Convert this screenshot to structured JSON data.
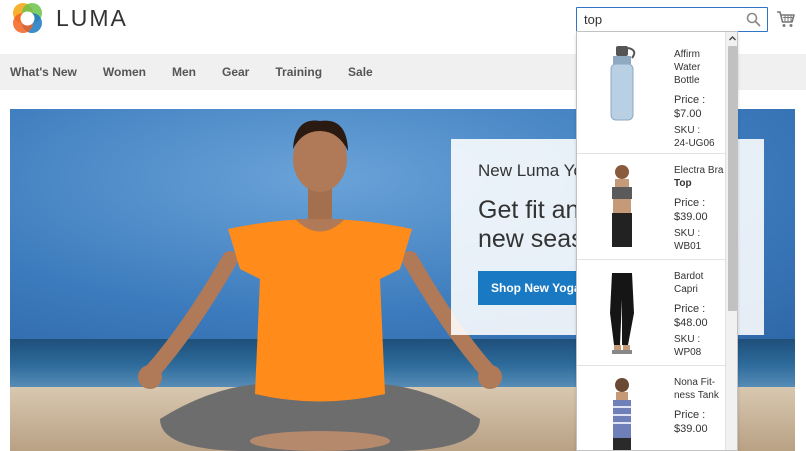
{
  "brand": {
    "name": "LUMA",
    "logo_colors": [
      "#f26322",
      "#f6a81c",
      "#6cc24a",
      "#1979c3"
    ]
  },
  "search": {
    "value": "top",
    "icon": "search-icon"
  },
  "cart": {
    "icon": "cart-icon"
  },
  "nav": {
    "items": [
      "What's New",
      "Women",
      "Men",
      "Gear",
      "Training",
      "Sale"
    ]
  },
  "hero": {
    "eyebrow": "New Luma Yoga Collection",
    "headline": "Get fit and look fab in new seasonal styles",
    "button": "Shop New Yoga"
  },
  "autocomplete": {
    "price_label": "Price :",
    "sku_label": "SKU :",
    "results": [
      {
        "name_pre": "Affirm Water Bottle",
        "name_match": "",
        "price": "$7.00",
        "sku": "24-UG06"
      },
      {
        "name_pre": "Electra Bra ",
        "name_match": "Top",
        "price": "$39.00",
        "sku": "WB01"
      },
      {
        "name_pre": "Bardot Capri",
        "name_match": "",
        "price": "$48.00",
        "sku": "WP08"
      },
      {
        "name_pre": "Nona Fit-ness Tank",
        "name_match": "",
        "price": "$39.00",
        "sku": ""
      }
    ]
  },
  "colors": {
    "accent": "#1979c3",
    "nav_bg": "#f0f0f0",
    "search_border": "#2e76c5"
  }
}
